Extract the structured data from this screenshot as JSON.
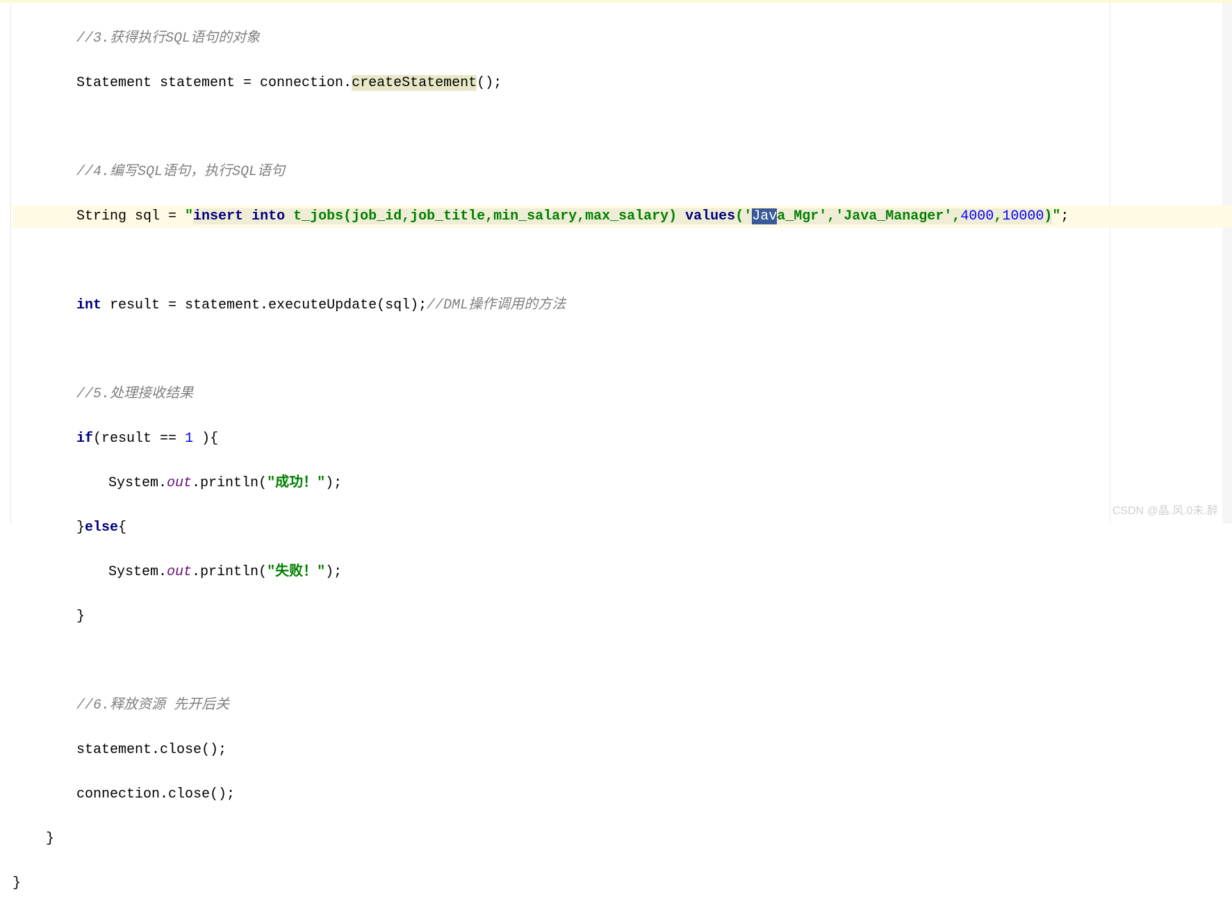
{
  "notification": {
    "text_left": ".................................... ....... .......... ............. ........... .......... .......... .........",
    "text_right": "............ ................"
  },
  "code": {
    "comment3": "//3.获得执行SQL语句的对象",
    "line_stmt_1": "Statement statement = connection.",
    "line_stmt_2": "createStatement",
    "line_stmt_3": "();",
    "comment4": "//4.编写SQL语句，执行SQL语句",
    "sql_1": "String sql = ",
    "sql_2": "\"",
    "sql_3": "insert into",
    "sql_4": " t_jobs(job_id,job_title,min_salary,max_salary) ",
    "sql_5": "values",
    "sql_6": "('",
    "sql_7_sel": "Jav",
    "sql_7_rest": "a_Mgr",
    "sql_8": "','",
    "sql_9": "Java_Manager",
    "sql_10": "',",
    "sql_11": "4000",
    "sql_12": ",",
    "sql_13": "10000",
    "sql_14": ")",
    "sql_15": "\"",
    "sql_16": ";",
    "result_1": "int",
    "result_2": " result = statement.executeUpdate(sql);",
    "result_comment": "//DML操作调用的方法",
    "comment5": "//5.处理接收结果",
    "if_1": "if",
    "if_2": "(result == ",
    "if_3": "1",
    "if_4": " ){",
    "print1_1": "System.",
    "print1_2": "out",
    "print1_3": ".println(",
    "print1_4": "\"成功！\"",
    "print1_5": ");",
    "else_1": "}",
    "else_2": "else",
    "else_3": "{",
    "print2_1": "System.",
    "print2_2": "out",
    "print2_3": ".println(",
    "print2_4": "\"失败！\"",
    "print2_5": ");",
    "close_brace": "}",
    "comment6": "//6.释放资源 先开后关",
    "close1": "statement.close();",
    "close2": "connection.close();",
    "brace1": "}",
    "brace2": "}"
  },
  "watermark": "CSDN @晶.风.0未.醉"
}
